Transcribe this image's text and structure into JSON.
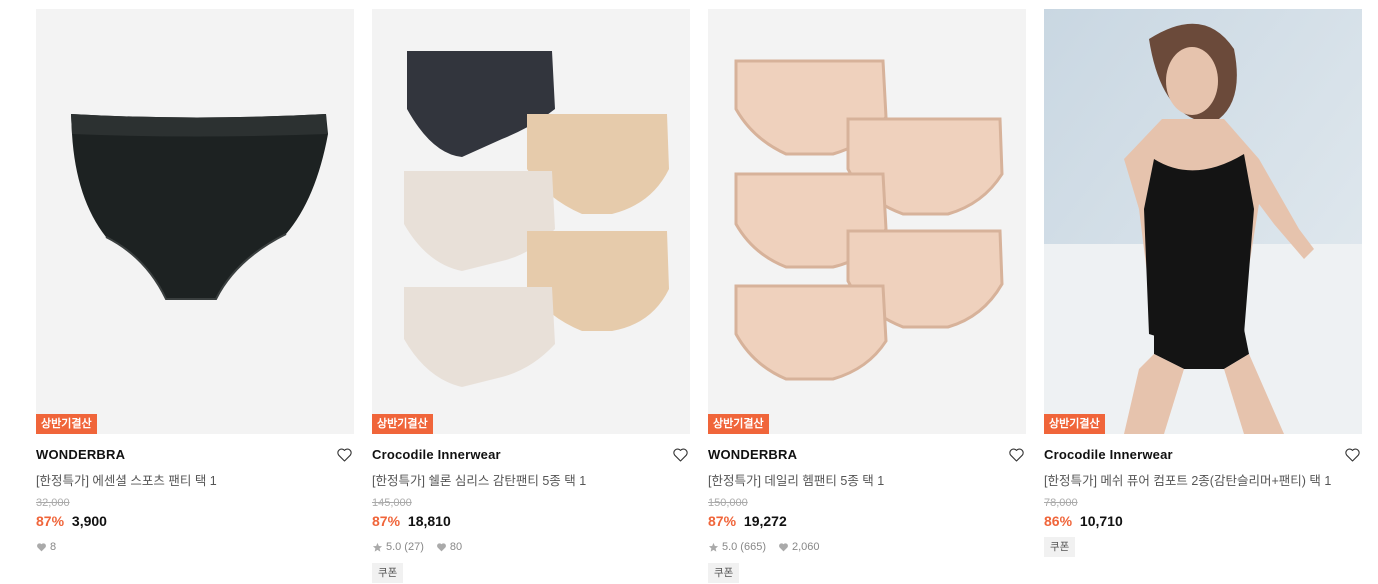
{
  "products": [
    {
      "badge": "상반기결산",
      "brand": "WONDERBRA",
      "title": "[한정특가] 에센셜 스포츠 팬티 택 1",
      "original_price": "32,000",
      "discount": "87%",
      "price": "3,900",
      "likes": "8",
      "image_icon": "single-black-panty-image"
    },
    {
      "badge": "상반기결산",
      "brand": "Crocodile Innerwear",
      "title": "[한정특가] 쉘론 심리스 감탄팬티 5종 택 1",
      "original_price": "145,000",
      "discount": "87%",
      "price": "18,810",
      "rating": "5.0",
      "reviews": "(27)",
      "likes": "80",
      "coupon": "쿠폰",
      "image_icon": "five-seamless-panties-image"
    },
    {
      "badge": "상반기결산",
      "brand": "WONDERBRA",
      "title": "[한정특가] 데일리 헴팬티 5종 택 1",
      "original_price": "150,000",
      "discount": "87%",
      "price": "19,272",
      "rating": "5.0",
      "reviews": "(665)",
      "likes": "2,060",
      "coupon": "쿠폰",
      "image_icon": "five-beige-panties-image"
    },
    {
      "badge": "상반기결산",
      "brand": "Crocodile Innerwear",
      "title": "[한정특가] 메쉬 퓨어 컴포트 2종(감탄슬리머+팬티) 택 1",
      "original_price": "78,000",
      "discount": "86%",
      "price": "10,710",
      "coupon": "쿠폰",
      "image_icon": "model-black-slimmer-image"
    }
  ],
  "colors": {
    "accent": "#f0653a",
    "text": "#111111",
    "muted": "#888888"
  }
}
